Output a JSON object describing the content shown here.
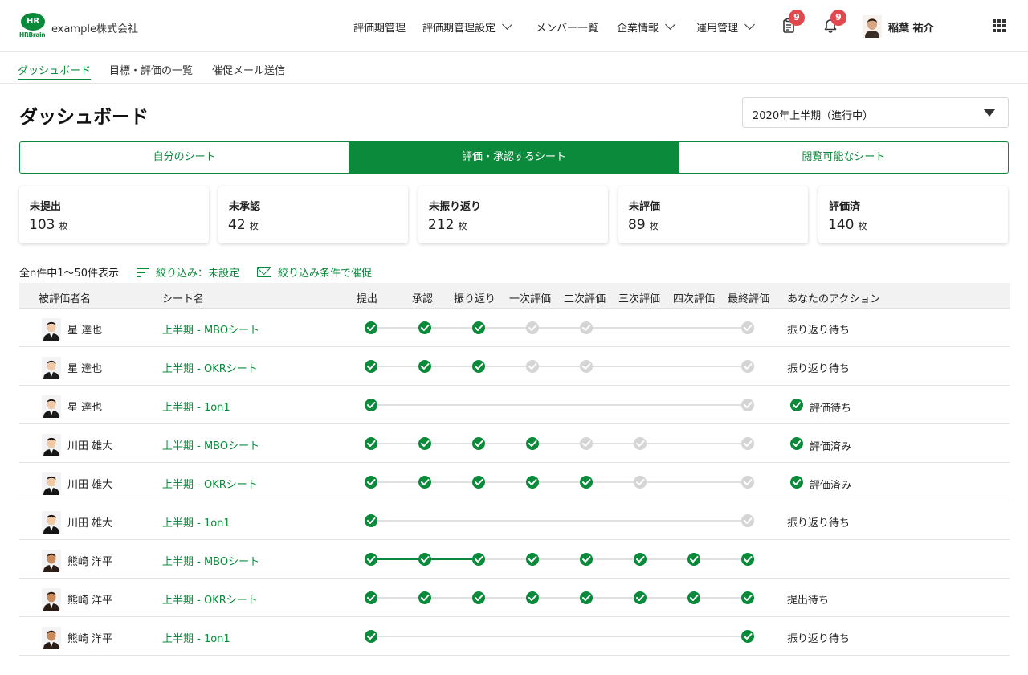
{
  "header": {
    "logo_text": "HR",
    "logo_brand": "HRBrain",
    "company": "example株式会社",
    "nav": [
      {
        "label": "評価期管理",
        "dropdown": false
      },
      {
        "label": "評価期管理設定",
        "dropdown": true
      },
      {
        "label": "メンバー一覧",
        "dropdown": false
      },
      {
        "label": "企業情報",
        "dropdown": true
      },
      {
        "label": "運用管理",
        "dropdown": true
      }
    ],
    "tasks_badge": "9",
    "notifications_badge": "9",
    "user_name": "稲葉 祐介",
    "accent_color": "#0a8a3a",
    "badge_color": "#e0484d"
  },
  "subnav": [
    "ダッシュボード",
    "目標・評価の一覧",
    "催促メール送信"
  ],
  "page": {
    "title": "ダッシュボード",
    "period": "2020年上半期（進行中）"
  },
  "tabs": [
    "自分のシート",
    "評価・承認するシート",
    "閲覧可能なシート"
  ],
  "stats": [
    {
      "label": "未提出",
      "value": "103",
      "unit": "枚"
    },
    {
      "label": "未承認",
      "value": "42",
      "unit": "枚"
    },
    {
      "label": "未振り返り",
      "value": "212",
      "unit": "枚"
    },
    {
      "label": "未評価",
      "value": "89",
      "unit": "枚"
    },
    {
      "label": "評価済",
      "value": "140",
      "unit": "枚"
    }
  ],
  "filter": {
    "count_text": "全n件中1〜50件表示",
    "filter_label": "絞り込み：未設定",
    "remind_label": "絞り込み条件で催促"
  },
  "table": {
    "headers": {
      "name": "被評価者名",
      "sheet": "シート名",
      "steps": [
        "提出",
        "承認",
        "振り返り",
        "一次評価",
        "二次評価",
        "三次評価",
        "四次評価",
        "最終評価"
      ],
      "action": "あなたのアクション"
    },
    "rows": [
      {
        "name": "星 達也",
        "sheet": "上半期 - MBOシート",
        "steps": [
          "done",
          "done",
          "done",
          "pending",
          "pending",
          null,
          null,
          "pending"
        ],
        "action": "振り返り待ち",
        "action_check": false
      },
      {
        "name": "星 達也",
        "sheet": "上半期 -  OKRシート",
        "steps": [
          "done",
          "done",
          "done",
          "pending",
          "pending",
          null,
          null,
          "pending"
        ],
        "action": "振り返り待ち",
        "action_check": false
      },
      {
        "name": "星 達也",
        "sheet": "上半期 - 1on1",
        "steps": [
          "done",
          null,
          null,
          null,
          null,
          null,
          null,
          "pending"
        ],
        "action": "評価待ち",
        "action_check": true
      },
      {
        "name": "川田 雄大",
        "sheet": "上半期 - MBOシート",
        "steps": [
          "done",
          "done",
          "done",
          "done",
          "pending",
          "pending",
          null,
          "pending"
        ],
        "action": "評価済み",
        "action_check": true
      },
      {
        "name": "川田 雄大",
        "sheet": "上半期 -  OKRシート",
        "steps": [
          "done",
          "done",
          "done",
          "done",
          "done",
          "pending",
          null,
          "pending"
        ],
        "action": "評価済み",
        "action_check": true
      },
      {
        "name": "川田 雄大",
        "sheet": "上半期 - 1on1",
        "steps": [
          "done",
          null,
          null,
          null,
          null,
          null,
          null,
          "pending"
        ],
        "action": "振り返り待ち",
        "action_check": false
      },
      {
        "name": "熊崎 洋平",
        "sheet": "上半期 - MBOシート",
        "steps": [
          "done",
          "done",
          "done",
          "done",
          "done",
          "done",
          "done",
          "done"
        ],
        "action": "",
        "action_check": false,
        "highlight_segments": 2
      },
      {
        "name": "熊崎 洋平",
        "sheet": "上半期 -  OKRシート",
        "steps": [
          "done",
          "done",
          "done",
          "done",
          "done",
          "done",
          "done",
          "done"
        ],
        "action": "提出待ち",
        "action_check": false
      },
      {
        "name": "熊崎 洋平",
        "sheet": "上半期 - 1on1",
        "steps": [
          "done",
          null,
          null,
          null,
          null,
          null,
          null,
          "done"
        ],
        "action": "振り返り待ち",
        "action_check": false
      }
    ]
  }
}
